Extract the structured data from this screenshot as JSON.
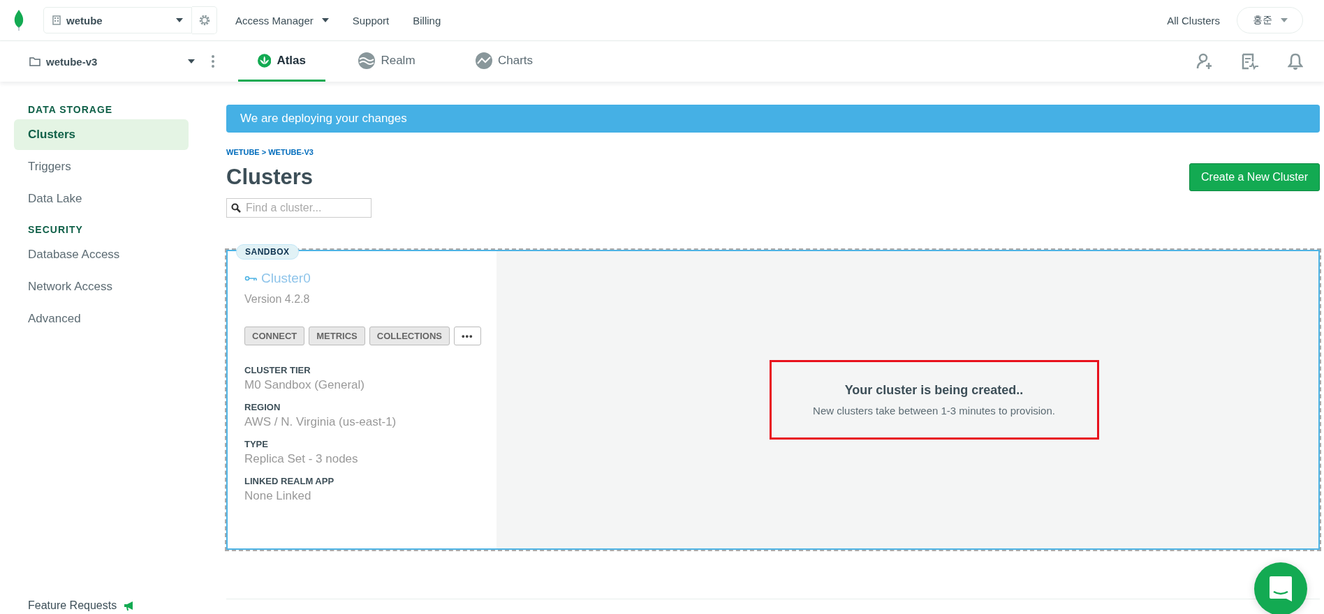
{
  "top_bar": {
    "org": "wetube",
    "nav": [
      {
        "label": "Access Manager",
        "has_menu": true
      },
      {
        "label": "Support",
        "has_menu": false
      },
      {
        "label": "Billing",
        "has_menu": false
      }
    ],
    "all_clusters": "All Clusters",
    "user": "홍준"
  },
  "project_bar": {
    "project": "wetube-v3",
    "tabs": [
      {
        "label": "Atlas",
        "selected": true
      },
      {
        "label": "Realm",
        "selected": false
      },
      {
        "label": "Charts",
        "selected": false
      }
    ]
  },
  "sidebar": {
    "sections": [
      {
        "title": "DATA STORAGE",
        "items": [
          {
            "label": "Clusters",
            "selected": true
          },
          {
            "label": "Triggers",
            "selected": false
          },
          {
            "label": "Data Lake",
            "selected": false
          }
        ]
      },
      {
        "title": "SECURITY",
        "items": [
          {
            "label": "Database Access",
            "selected": false
          },
          {
            "label": "Network Access",
            "selected": false
          },
          {
            "label": "Advanced",
            "selected": false
          }
        ]
      }
    ],
    "footer": "Feature Requests"
  },
  "banner": "We are deploying your changes",
  "breadcrumb": "WETUBE > WETUBE-V3",
  "title": "Clusters",
  "create_button": "Create a New Cluster",
  "search": {
    "placeholder": "Find a cluster..."
  },
  "cluster": {
    "badge": "SANDBOX",
    "name": "Cluster0",
    "version": "Version 4.2.8",
    "actions": [
      "CONNECT",
      "METRICS",
      "COLLECTIONS",
      "•••"
    ],
    "details": [
      {
        "label": "CLUSTER TIER",
        "value": "M0 Sandbox (General)"
      },
      {
        "label": "REGION",
        "value": "AWS / N. Virginia (us-east-1)"
      },
      {
        "label": "TYPE",
        "value": "Replica Set - 3 nodes"
      },
      {
        "label": "LINKED REALM APP",
        "value": "None Linked"
      }
    ],
    "status_title": "Your cluster is being created..",
    "status_text": "New clusters take between 1-3 minutes to provision."
  }
}
